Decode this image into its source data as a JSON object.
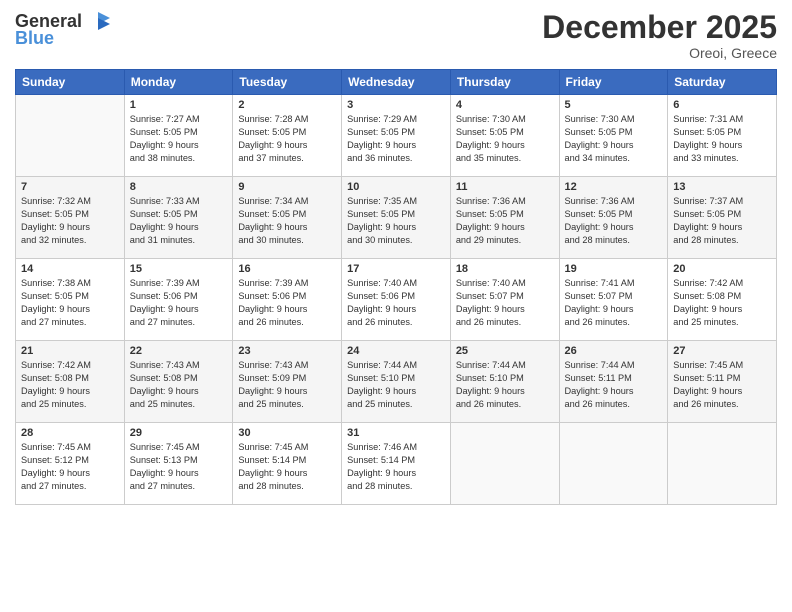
{
  "logo": {
    "general": "General",
    "blue": "Blue"
  },
  "title": "December 2025",
  "location": "Oreoi, Greece",
  "days_of_week": [
    "Sunday",
    "Monday",
    "Tuesday",
    "Wednesday",
    "Thursday",
    "Friday",
    "Saturday"
  ],
  "weeks": [
    [
      {
        "num": "",
        "info": ""
      },
      {
        "num": "1",
        "info": "Sunrise: 7:27 AM\nSunset: 5:05 PM\nDaylight: 9 hours\nand 38 minutes."
      },
      {
        "num": "2",
        "info": "Sunrise: 7:28 AM\nSunset: 5:05 PM\nDaylight: 9 hours\nand 37 minutes."
      },
      {
        "num": "3",
        "info": "Sunrise: 7:29 AM\nSunset: 5:05 PM\nDaylight: 9 hours\nand 36 minutes."
      },
      {
        "num": "4",
        "info": "Sunrise: 7:30 AM\nSunset: 5:05 PM\nDaylight: 9 hours\nand 35 minutes."
      },
      {
        "num": "5",
        "info": "Sunrise: 7:30 AM\nSunset: 5:05 PM\nDaylight: 9 hours\nand 34 minutes."
      },
      {
        "num": "6",
        "info": "Sunrise: 7:31 AM\nSunset: 5:05 PM\nDaylight: 9 hours\nand 33 minutes."
      }
    ],
    [
      {
        "num": "7",
        "info": "Sunrise: 7:32 AM\nSunset: 5:05 PM\nDaylight: 9 hours\nand 32 minutes."
      },
      {
        "num": "8",
        "info": "Sunrise: 7:33 AM\nSunset: 5:05 PM\nDaylight: 9 hours\nand 31 minutes."
      },
      {
        "num": "9",
        "info": "Sunrise: 7:34 AM\nSunset: 5:05 PM\nDaylight: 9 hours\nand 30 minutes."
      },
      {
        "num": "10",
        "info": "Sunrise: 7:35 AM\nSunset: 5:05 PM\nDaylight: 9 hours\nand 30 minutes."
      },
      {
        "num": "11",
        "info": "Sunrise: 7:36 AM\nSunset: 5:05 PM\nDaylight: 9 hours\nand 29 minutes."
      },
      {
        "num": "12",
        "info": "Sunrise: 7:36 AM\nSunset: 5:05 PM\nDaylight: 9 hours\nand 28 minutes."
      },
      {
        "num": "13",
        "info": "Sunrise: 7:37 AM\nSunset: 5:05 PM\nDaylight: 9 hours\nand 28 minutes."
      }
    ],
    [
      {
        "num": "14",
        "info": "Sunrise: 7:38 AM\nSunset: 5:05 PM\nDaylight: 9 hours\nand 27 minutes."
      },
      {
        "num": "15",
        "info": "Sunrise: 7:39 AM\nSunset: 5:06 PM\nDaylight: 9 hours\nand 27 minutes."
      },
      {
        "num": "16",
        "info": "Sunrise: 7:39 AM\nSunset: 5:06 PM\nDaylight: 9 hours\nand 26 minutes."
      },
      {
        "num": "17",
        "info": "Sunrise: 7:40 AM\nSunset: 5:06 PM\nDaylight: 9 hours\nand 26 minutes."
      },
      {
        "num": "18",
        "info": "Sunrise: 7:40 AM\nSunset: 5:07 PM\nDaylight: 9 hours\nand 26 minutes."
      },
      {
        "num": "19",
        "info": "Sunrise: 7:41 AM\nSunset: 5:07 PM\nDaylight: 9 hours\nand 26 minutes."
      },
      {
        "num": "20",
        "info": "Sunrise: 7:42 AM\nSunset: 5:08 PM\nDaylight: 9 hours\nand 25 minutes."
      }
    ],
    [
      {
        "num": "21",
        "info": "Sunrise: 7:42 AM\nSunset: 5:08 PM\nDaylight: 9 hours\nand 25 minutes."
      },
      {
        "num": "22",
        "info": "Sunrise: 7:43 AM\nSunset: 5:08 PM\nDaylight: 9 hours\nand 25 minutes."
      },
      {
        "num": "23",
        "info": "Sunrise: 7:43 AM\nSunset: 5:09 PM\nDaylight: 9 hours\nand 25 minutes."
      },
      {
        "num": "24",
        "info": "Sunrise: 7:44 AM\nSunset: 5:10 PM\nDaylight: 9 hours\nand 25 minutes."
      },
      {
        "num": "25",
        "info": "Sunrise: 7:44 AM\nSunset: 5:10 PM\nDaylight: 9 hours\nand 26 minutes."
      },
      {
        "num": "26",
        "info": "Sunrise: 7:44 AM\nSunset: 5:11 PM\nDaylight: 9 hours\nand 26 minutes."
      },
      {
        "num": "27",
        "info": "Sunrise: 7:45 AM\nSunset: 5:11 PM\nDaylight: 9 hours\nand 26 minutes."
      }
    ],
    [
      {
        "num": "28",
        "info": "Sunrise: 7:45 AM\nSunset: 5:12 PM\nDaylight: 9 hours\nand 27 minutes."
      },
      {
        "num": "29",
        "info": "Sunrise: 7:45 AM\nSunset: 5:13 PM\nDaylight: 9 hours\nand 27 minutes."
      },
      {
        "num": "30",
        "info": "Sunrise: 7:45 AM\nSunset: 5:14 PM\nDaylight: 9 hours\nand 28 minutes."
      },
      {
        "num": "31",
        "info": "Sunrise: 7:46 AM\nSunset: 5:14 PM\nDaylight: 9 hours\nand 28 minutes."
      },
      {
        "num": "",
        "info": ""
      },
      {
        "num": "",
        "info": ""
      },
      {
        "num": "",
        "info": ""
      }
    ]
  ]
}
